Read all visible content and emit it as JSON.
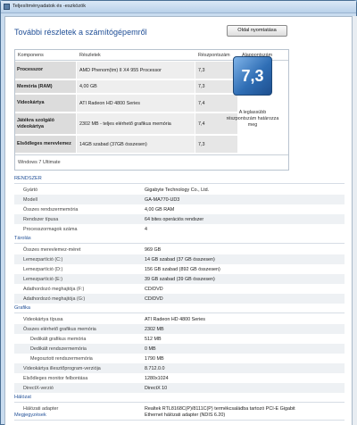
{
  "window": {
    "title": "Teljesítményadatok és -eszközök"
  },
  "header": {
    "heading": "További részletek a számítógépemről",
    "print_button": "Oldal nyomtatása"
  },
  "summary": {
    "columns": [
      "Komponens",
      "Részletek",
      "Részpontszám",
      "Alappontszám"
    ],
    "rows": [
      {
        "component": "Processzor",
        "details": "AMD Phenom(tm) II X4 955 Processor",
        "score": "7,3"
      },
      {
        "component": "Memória (RAM)",
        "details": "4,00 GB",
        "score": "7,3"
      },
      {
        "component": "Videokártya",
        "details": "ATI Radeon HD 4800 Series",
        "score": "7,4"
      },
      {
        "component": "Játékra szolgáló videokártya",
        "details": "2302 MB - teljes elérhető grafikus memória",
        "score": "7,4"
      },
      {
        "component": "Elsődleges merevlemez",
        "details": "14GB szabad (37GB összesen)",
        "score": "7,3"
      }
    ],
    "base_score": "7,3",
    "base_score_note": "A leglassúbb részpontszám határozza meg",
    "windows_version": "Windows 7 Ultimate"
  },
  "sections": {
    "system": {
      "title": "RENDSZER",
      "rows": [
        {
          "label": "Gyártó",
          "value": "Gigabyte Technology Co., Ltd."
        },
        {
          "label": "Modell",
          "value": "GA-MA770-UD3"
        },
        {
          "label": "Összes rendszermemória",
          "value": "4,00 GB RAM"
        },
        {
          "label": "Rendszer típusa",
          "value": "64 bites operációs rendszer"
        },
        {
          "label": "Processzormagok száma",
          "value": "4"
        }
      ]
    },
    "storage": {
      "title": "Tárolás",
      "rows": [
        {
          "label": "Összes merevlemez-méret",
          "value": "969 GB"
        },
        {
          "label": "Lemezpartíció (C:)",
          "value": "14 GB szabad (37 GB összesen)"
        },
        {
          "label": "Lemezpartíció (D:)",
          "value": "156 GB szabad (892 GB összesen)"
        },
        {
          "label": "Lemezpartíció (E:)",
          "value": "39 GB szabad (39 GB összesen)"
        },
        {
          "label": "Adathordozó meghajtója (F:)",
          "value": "CD/DVD"
        },
        {
          "label": "Adathordozó meghajtója (G:)",
          "value": "CD/DVD"
        }
      ]
    },
    "graphics": {
      "title": "Grafika",
      "rows": [
        {
          "label": "Videokártya típusa",
          "value": "ATI Radeon HD 4800 Series"
        },
        {
          "label": "Összes elérhető grafikus memória",
          "value": "2302 MB"
        },
        {
          "label": "Dedikált grafikus memória",
          "value": "512 MB"
        },
        {
          "label": "Dedikált rendszermemória",
          "value": "0 MB"
        },
        {
          "label": "Megosztott rendszermemória",
          "value": "1790 MB"
        },
        {
          "label": "Videokártya illesztőprogram-verziója",
          "value": "8.712.0.0"
        },
        {
          "label": "Elsődleges monitor felbontása",
          "value": "1280x1024"
        },
        {
          "label": "DirectX-verzió",
          "value": "DirectX 10"
        }
      ]
    },
    "network": {
      "title": "Hálózat",
      "rows": [
        {
          "label": "Hálózati adapter",
          "value": "Realtek RTL8168C(P)/8111C(P) termékcsaládba tartozó PCI-E Gigabit Ethernet hálózati adapter (NDIS 6.20)"
        }
      ]
    },
    "notes": {
      "title": "Megjegyzések"
    }
  },
  "colors": {
    "accent": "#1f4e96",
    "score_tile": "#2f6eb5",
    "window_frame": "#c9dcef"
  }
}
